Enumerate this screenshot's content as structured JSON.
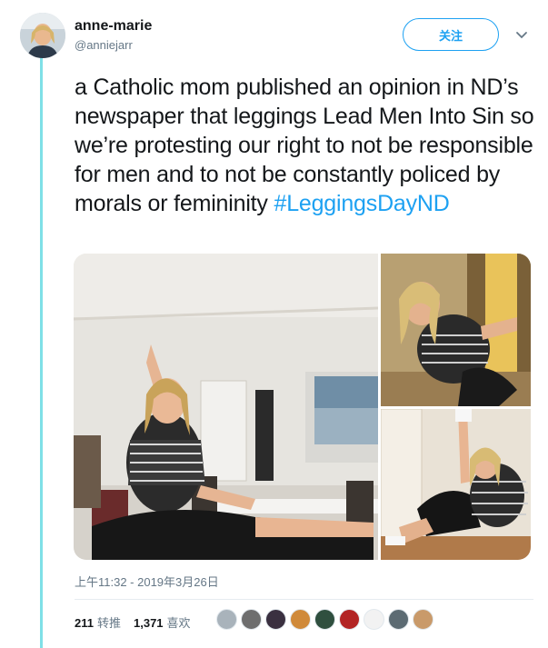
{
  "user": {
    "name": "anne-marie",
    "handle": "@anniejarr",
    "follow_label": "关注"
  },
  "tweet": {
    "text": "a Catholic mom published an opinion in ND’s newspaper that leggings Lead Men Into Sin so we’re protesting our right to not be responsible for men and to not be constantly policed by morals or femininity ",
    "hashtag": "#LeggingsDayND",
    "timestamp": "上午11:32 - 2019年3月26日"
  },
  "stats": {
    "retweets_count": "211",
    "retweets_label": "转推",
    "likes_count": "1,371",
    "likes_label": "喜欢"
  },
  "liker_colors": [
    "#a9b3bb",
    "#6e6e6e",
    "#3a3040",
    "#d08a3a",
    "#2f4f3f",
    "#b32424",
    "#f2f2f2",
    "#5c6b73",
    "#c99a6a"
  ],
  "colors": {
    "accent": "#1da1f2",
    "thread_line": "#7fe0e7",
    "muted_text": "#657786"
  },
  "icons": {
    "menu": "chevron-down-icon"
  }
}
